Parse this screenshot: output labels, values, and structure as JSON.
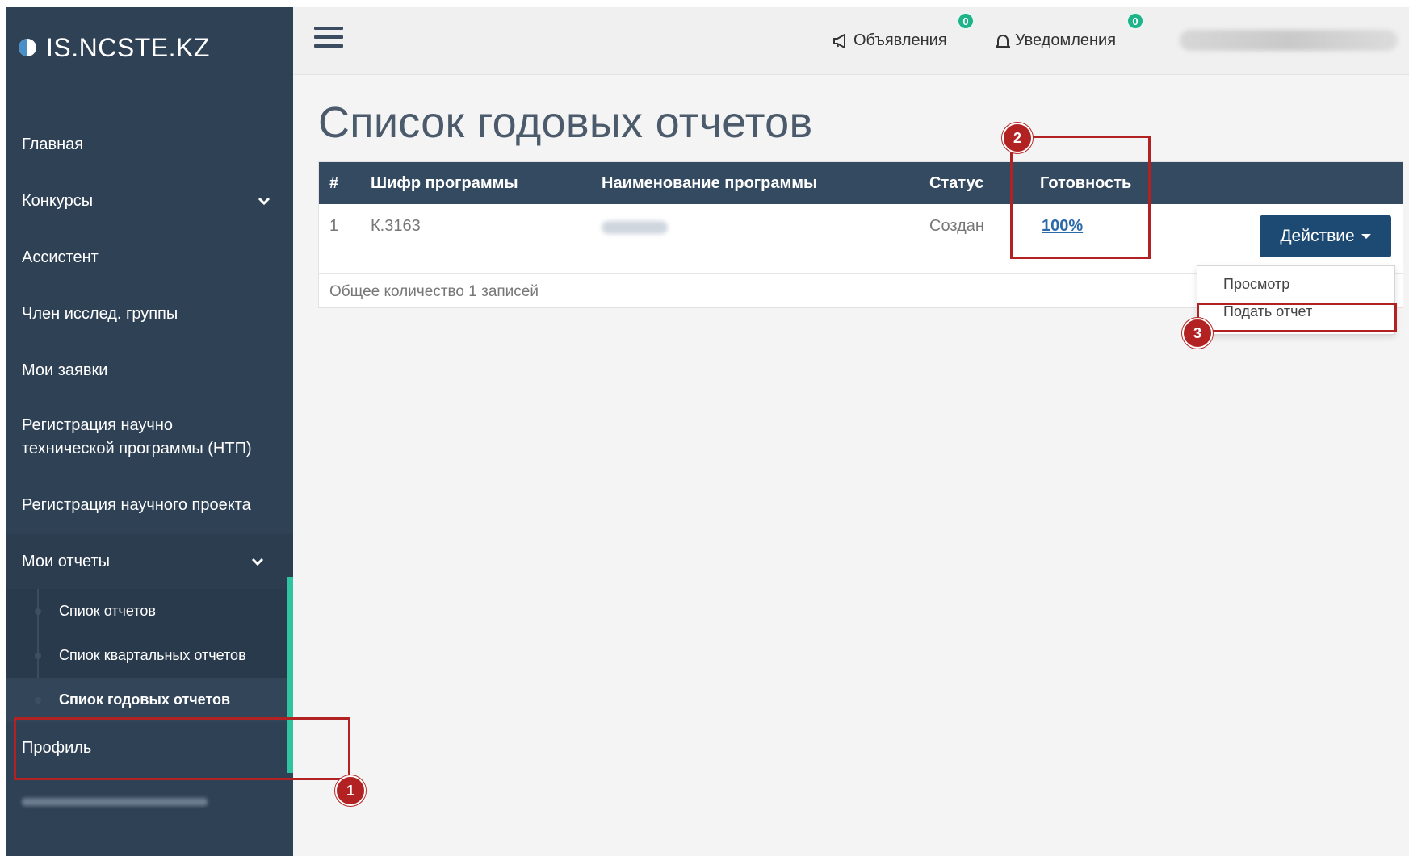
{
  "brand": {
    "name": "IS.NCSTE.KZ"
  },
  "sidebar": {
    "items": [
      {
        "label": "Главная"
      },
      {
        "label": "Конкурсы"
      },
      {
        "label": "Ассистент"
      },
      {
        "label": "Член исслед. группы"
      },
      {
        "label": "Мои заявки"
      },
      {
        "label": "Регистрация научно технической программы (НТП)"
      },
      {
        "label": "Регистрация научного проекта"
      },
      {
        "label": "Мои отчеты"
      },
      {
        "label": "Профиль"
      }
    ],
    "submenu": [
      {
        "label": "Спиок отчетов"
      },
      {
        "label": "Спиок квартальных отчетов"
      },
      {
        "label": "Спиок годовых отчетов"
      }
    ]
  },
  "topbar": {
    "announcements_label": "Объявления",
    "announcements_count": "0",
    "notifications_label": "Уведомления",
    "notifications_count": "0"
  },
  "main": {
    "title": "Список годовых отчетов",
    "table": {
      "headers": [
        "#",
        "Шифр программы",
        "Наименование программы",
        "Статус",
        "Готовность"
      ],
      "rows": [
        {
          "num": "1",
          "code": "К.3163",
          "status": "Создан",
          "readiness": "100%"
        }
      ]
    },
    "footer": "Общее количество 1 записей",
    "action_button": "Действие",
    "dropdown": [
      "Просмотр",
      "Подать отчет"
    ]
  },
  "annotations": [
    "1",
    "2",
    "3"
  ],
  "colors": {
    "sidebar_bg": "#2f4155",
    "table_header_bg": "#344a61",
    "action_button_bg": "#1d4a73",
    "badge_green": "#1fb38a",
    "annotation_red": "#b32222",
    "active_accent": "#2ec4a0"
  }
}
